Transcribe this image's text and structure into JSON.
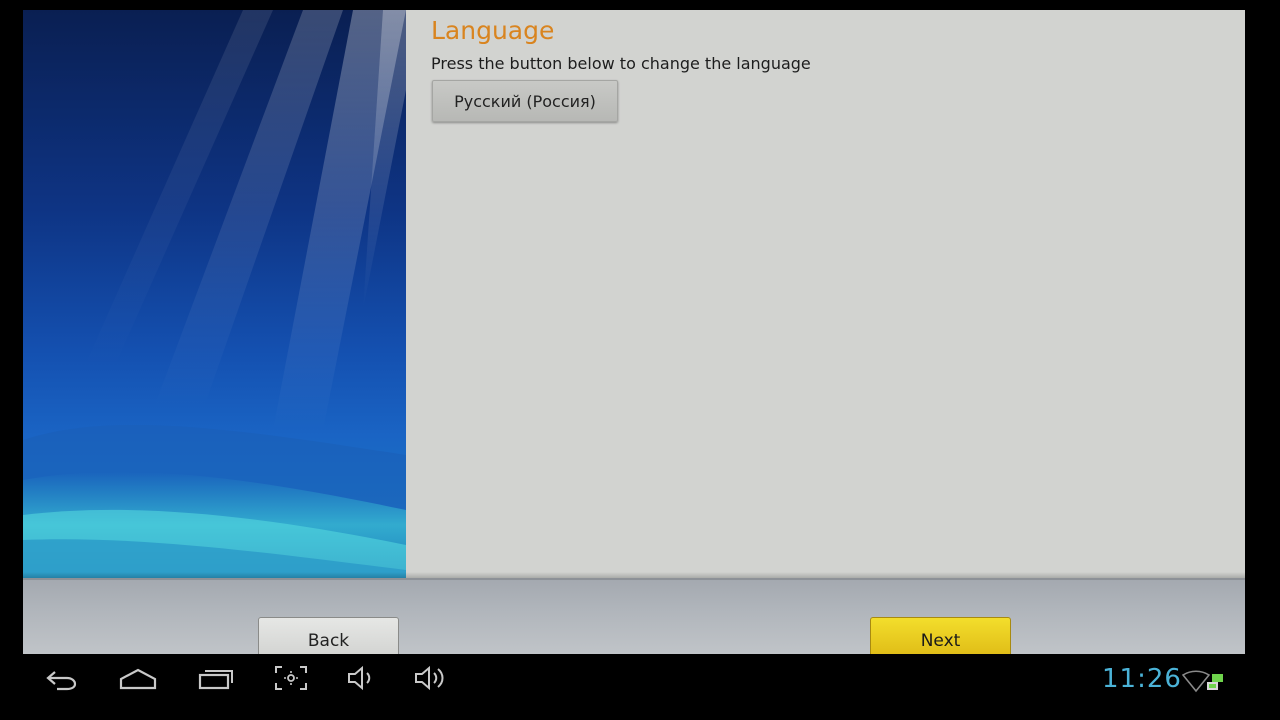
{
  "screen": {
    "title": "Language",
    "subtitle": "Press the button below to change the language",
    "language_button_label": "Русский (Россия)"
  },
  "footer": {
    "back_label": "Back",
    "next_label": "Next"
  },
  "system_bar": {
    "time": "11:26",
    "icons": [
      "back-icon",
      "home-icon",
      "recent-apps-icon",
      "screenshot-icon",
      "volume-down-icon",
      "volume-up-icon",
      "wifi-icon",
      "network-status-icon"
    ]
  },
  "colors": {
    "title": "#d9841f",
    "next_button": "#e8c81e",
    "clock": "#4bb3d8",
    "content_background": "#d2d3d0"
  }
}
